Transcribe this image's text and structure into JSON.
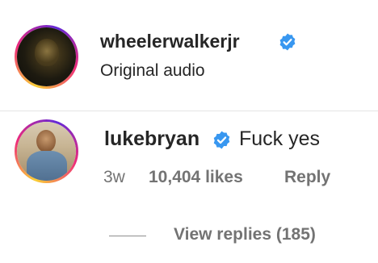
{
  "post": {
    "username": "wheelerwalkerjr",
    "verified": true,
    "subtitle": "Original audio"
  },
  "comment": {
    "username": "lukebryan",
    "verified": true,
    "text": "Fuck yes",
    "time_ago": "3w",
    "likes": "10,404 likes",
    "reply_label": "Reply",
    "view_replies_label": "View replies (185)"
  },
  "colors": {
    "verified_badge": "#3897f0",
    "primary_text": "#262626",
    "secondary_text": "#737373",
    "divider": "#e4e4e4"
  },
  "icons": {
    "verified": "verified-badge-icon"
  }
}
